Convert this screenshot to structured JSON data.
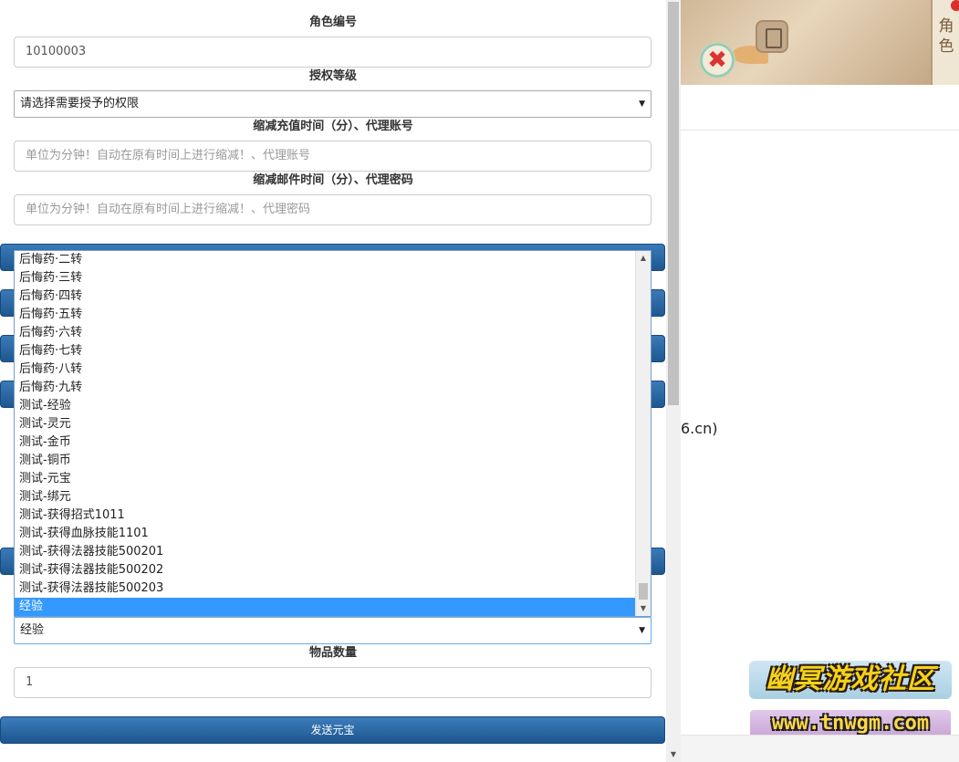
{
  "form": {
    "role_id_label": "角色编号",
    "role_id_value": "10100003",
    "auth_level_label": "授权等级",
    "auth_level_value": "请选择需要授予的权限",
    "recharge_time_label": "缩减充值时间（分）、代理账号",
    "recharge_time_placeholder": "单位为分钟！自动在原有时间上进行缩减！、代理账号",
    "mail_time_label": "缩减邮件时间（分）、代理密码",
    "mail_time_placeholder": "单位为分钟！自动在原有时间上进行缩减！、代理密码",
    "item_select_value": "经验",
    "quantity_label": "物品数量",
    "quantity_value": "1",
    "send_button_label": "发送元宝"
  },
  "dropdown": {
    "items": [
      "后悔药·二转",
      "后悔药·三转",
      "后悔药·四转",
      "后悔药·五转",
      "后悔药·六转",
      "后悔药·七转",
      "后悔药·八转",
      "后悔药·九转",
      "测试-经验",
      "测试-灵元",
      "测试-金币",
      "测试-铜币",
      "测试-元宝",
      "测试-绑元",
      "测试-获得招式1011",
      "测试-获得血脉技能1101",
      "测试-获得法器技能500201",
      "测试-获得法器技能500202",
      "测试-获得法器技能500203",
      "经验"
    ],
    "selected": "经验"
  },
  "right": {
    "game_side_text": "角色",
    "url_fragment": "6.cn)",
    "watermark_title": "幽冥游戏社区",
    "watermark_url": "www.tnwgm.com"
  },
  "icons": {
    "select_arrow": "▼",
    "scroll_up": "▲",
    "scroll_down": "▼",
    "close_glyph": "✖"
  },
  "colors": {
    "button_blue": "#2a6aa6",
    "selected_item": "#3399ff"
  }
}
